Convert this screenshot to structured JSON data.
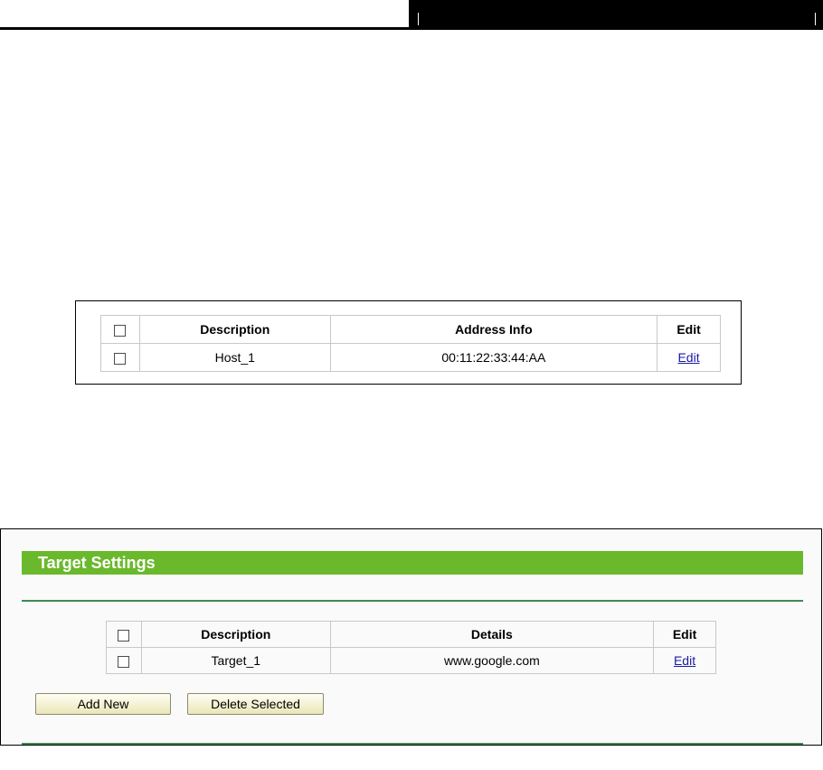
{
  "host_table": {
    "headers": {
      "description": "Description",
      "address_info": "Address Info",
      "edit": "Edit"
    },
    "rows": [
      {
        "description": "Host_1",
        "address_info": "00:11:22:33:44:AA",
        "edit": "Edit"
      }
    ]
  },
  "target_settings": {
    "title": "Target Settings",
    "headers": {
      "description": "Description",
      "details": "Details",
      "edit": "Edit"
    },
    "rows": [
      {
        "description": "Target_1",
        "details": "www.google.com",
        "edit": "Edit"
      }
    ],
    "add_new_label": "Add New",
    "delete_selected_label": "Delete Selected"
  },
  "colors": {
    "section_header_green": "#6ab92c",
    "divider_green": "#3f8a53",
    "link_blue": "#1a1aa6"
  }
}
